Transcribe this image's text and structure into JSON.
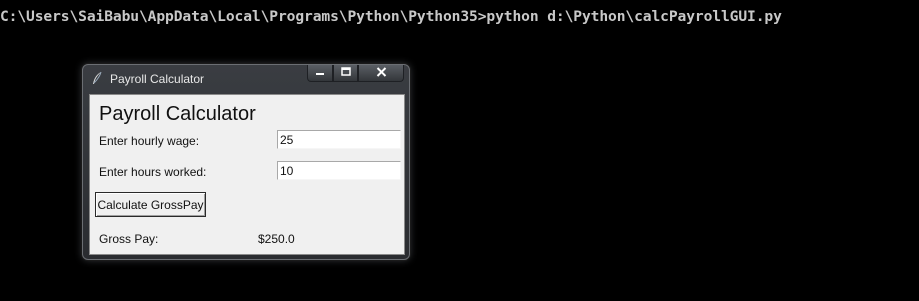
{
  "console": {
    "command_line": "C:\\Users\\SaiBabu\\AppData\\Local\\Programs\\Python\\Python35>python d:\\Python\\calcPayrollGUI.py"
  },
  "window": {
    "title": "Payroll Calculator",
    "icon": "feather-icon",
    "controls": [
      "minimize-icon",
      "maximize-icon",
      "close-icon"
    ]
  },
  "form": {
    "heading": "Payroll Calculator",
    "wage_label": "Enter hourly wage:",
    "wage_value": "25",
    "hours_label": "Enter hours worked:",
    "hours_value": "10",
    "calculate_label": "Calculate GrossPay",
    "gross_label": "Gross Pay:",
    "gross_value": "$250.0"
  }
}
